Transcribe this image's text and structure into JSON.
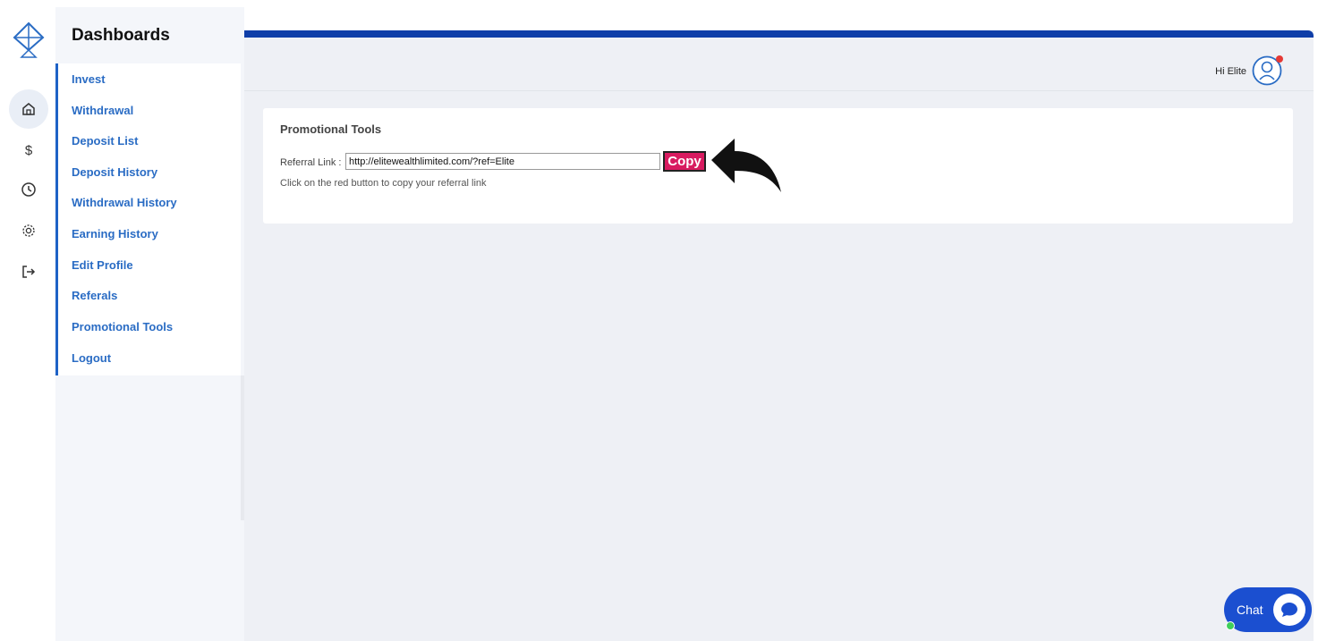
{
  "sidebar": {
    "title": "Dashboards",
    "items": [
      {
        "label": "Invest"
      },
      {
        "label": "Withdrawal"
      },
      {
        "label": "Deposit List"
      },
      {
        "label": "Deposit History"
      },
      {
        "label": "Withdrawal History"
      },
      {
        "label": "Earning History"
      },
      {
        "label": "Edit Profile"
      },
      {
        "label": "Referals"
      },
      {
        "label": "Promotional Tools"
      },
      {
        "label": "Logout"
      }
    ]
  },
  "rail": {
    "icons": [
      "home-icon",
      "dollar-icon",
      "clock-icon",
      "gear-icon",
      "logout-icon"
    ],
    "active": "home-icon"
  },
  "header": {
    "greeting": "Hi Elite"
  },
  "card": {
    "title": "Promotional Tools",
    "referral_label": "Referral Link :",
    "referral_value": "http://elitewealthlimited.com/?ref=Elite",
    "copy_label": "Copy",
    "help_text": "Click on the red button to copy your referral link"
  },
  "chat": {
    "label": "Chat"
  },
  "colors": {
    "accent": "#1e62c6",
    "topbar": "#0f3ea8",
    "copy_button": "#d81b60",
    "chat": "#1b4fd0"
  }
}
